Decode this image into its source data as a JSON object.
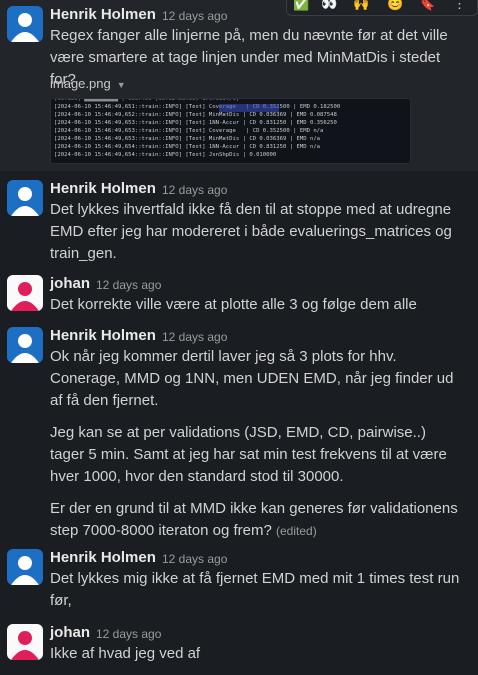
{
  "toolbar": {
    "reactions": [
      "✅",
      "👀",
      "🙌",
      "😊",
      "🔖",
      "⋮"
    ]
  },
  "messages": [
    {
      "author": "Henrik Holmen",
      "time": "12 days ago",
      "avatar": "blue",
      "paragraphs": [
        "Regex fanger alle linjerne på, men du nævnte før at det ville være smartere at tage linjen under med MinMatDis i stedet for?"
      ],
      "attachment": {
        "name": "image.png",
        "log_lines": [
          "[2024-06-10 15:46:49,651::train::INFO] [Test] Coverage   | CD 0.352500 | EMD 0.182500",
          "[2024-06-10 15:46:49,652::train::INFO] [Test] MinMatDis | CD 0.036369 | EMD 0.087548",
          "[2024-06-10 15:46:49,653::train::INFO] [Test] 1NN-Accur | CD 0.831250 | EMD 0.356250",
          "[2024-06-10 15:46:49,653::train::INFO] [Test] Coverage   | CD 0.352500 | EMD n/a",
          "[2024-06-10 15:46:49,653::train::INFO] [Test] MinMatDis | CD 0.036369 | EMD n/a",
          "[2024-06-10 15:46:49,654::train::INFO] [Test] 1NN-Accur | CD 0.831250 | EMD n/a",
          "[2024-06-10 15:46:49,654::train::INFO] [Test] JsnShpDis | 0.010000"
        ]
      }
    },
    {
      "author": "Henrik Holmen",
      "time": "12 days ago",
      "avatar": "blue",
      "paragraphs": [
        "Det lykkes ihvertfald ikke få den til at stoppe med at udregne EMD efter jeg har modereret i både evaluerings_matrices og train_gen."
      ]
    },
    {
      "author": "johan",
      "time": "12 days ago",
      "avatar": "pink",
      "paragraphs": [
        "Det korrekte ville være at plotte alle 3 og følge dem alle"
      ]
    },
    {
      "author": "Henrik Holmen",
      "time": "12 days ago",
      "avatar": "blue",
      "paragraphs": [
        "Ok når jeg kommer dertil laver jeg så 3 plots for hhv. Conerage, MMD og 1NN, men UDEN EMD, når jeg finder ud af få den fjernet.",
        "Jeg kan se at per validations (JSD, EMD, CD, pairwise..) tager 5 min. Samt at jeg har sat min test frekvens til at være hver 1000, hvor den standard stod til 30000.",
        "Er der en grund til at MMD ikke kan generes før validationens step 7000-8000 iteraton og frem?"
      ],
      "edited": "(edited)"
    },
    {
      "author": "Henrik Holmen",
      "time": "12 days ago",
      "avatar": "blue",
      "paragraphs": [
        "Det lykkes mig ikke at få fjernet EMD med mit 1 times test run før,"
      ]
    },
    {
      "author": "johan",
      "time": "12 days ago",
      "avatar": "pink",
      "paragraphs": [
        "Ikke af hvad jeg ved af"
      ]
    }
  ]
}
